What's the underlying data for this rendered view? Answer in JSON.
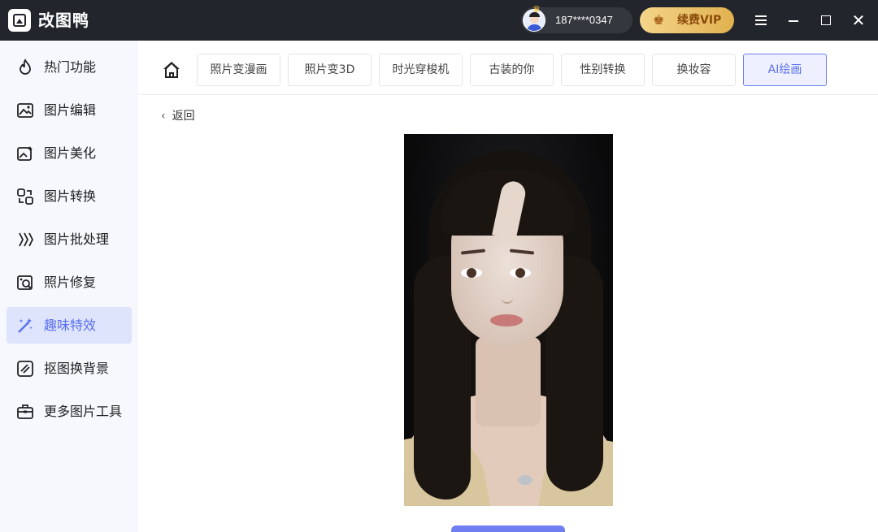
{
  "titlebar": {
    "app_title": "改图鸭",
    "user_phone": "187****0347",
    "vip_label": "续费VIP",
    "vip_icon": "crown-icon"
  },
  "sidebar": {
    "items": [
      {
        "label": "热门功能",
        "icon": "fire-icon",
        "active": false
      },
      {
        "label": "图片编辑",
        "icon": "image-edit-icon",
        "active": false
      },
      {
        "label": "图片美化",
        "icon": "image-beautify-icon",
        "active": false
      },
      {
        "label": "图片转换",
        "icon": "convert-icon",
        "active": false
      },
      {
        "label": "图片批处理",
        "icon": "batch-icon",
        "active": false
      },
      {
        "label": "照片修复",
        "icon": "photo-repair-icon",
        "active": false
      },
      {
        "label": "趣味特效",
        "icon": "magic-wand-icon",
        "active": true
      },
      {
        "label": "抠图换背景",
        "icon": "cutout-icon",
        "active": false
      },
      {
        "label": "更多图片工具",
        "icon": "toolbox-icon",
        "active": false
      }
    ]
  },
  "main": {
    "tabs": [
      {
        "label": "照片变漫画",
        "active": false
      },
      {
        "label": "照片变3D",
        "active": false
      },
      {
        "label": "时光穿梭机",
        "active": false
      },
      {
        "label": "古装的你",
        "active": false
      },
      {
        "label": "性别转换",
        "active": false
      },
      {
        "label": "换妆容",
        "active": false
      },
      {
        "label": "AI绘画",
        "active": true
      }
    ],
    "back_label": "返回"
  },
  "colors": {
    "accent": "#5b6ff0",
    "titlebar_bg": "#22252b",
    "vip_gold": "#e0b14f"
  }
}
